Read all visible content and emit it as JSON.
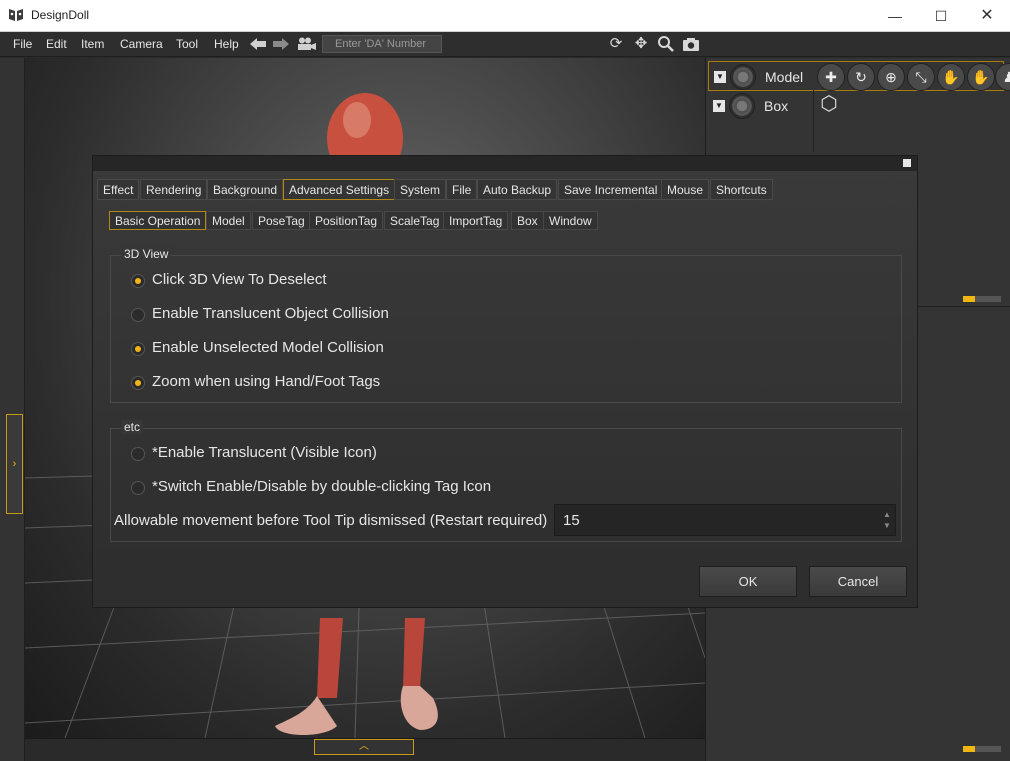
{
  "window": {
    "title": "DesignDoll"
  },
  "menu": {
    "items": [
      "File",
      "Edit",
      "Item",
      "Camera",
      "Tool",
      "Help"
    ],
    "da_placeholder": "Enter 'DA' Number"
  },
  "scene": {
    "objects": [
      "Model",
      "Box"
    ]
  },
  "dialog": {
    "tabs": [
      "Effect",
      "Rendering",
      "Background",
      "Advanced Settings",
      "System",
      "File",
      "Auto Backup",
      "Save Incremental",
      "Mouse",
      "Shortcuts"
    ],
    "active_tab": "Advanced Settings",
    "subtabs": [
      "Basic Operation",
      "Model",
      "PoseTag",
      "PositionTag",
      "ScaleTag",
      "ImportTag",
      "Box",
      "Window"
    ],
    "active_subtab": "Basic Operation",
    "group_3dview": {
      "title": "3D View",
      "options": [
        {
          "label": "Click 3D View To Deselect",
          "selected": true
        },
        {
          "label": "Enable Translucent Object Collision",
          "selected": false
        },
        {
          "label": "Enable Unselected Model Collision",
          "selected": true
        },
        {
          "label": "Zoom when using Hand/Foot Tags",
          "selected": true
        }
      ]
    },
    "group_etc": {
      "title": "etc",
      "options": [
        {
          "label": "*Enable Translucent (Visible Icon)",
          "selected": false
        },
        {
          "label": "*Switch Enable/Disable by double-clicking Tag Icon",
          "selected": false
        }
      ],
      "movement_label": "Allowable movement before Tool Tip dismissed (Restart required)",
      "movement_value": "15"
    },
    "ok_label": "OK",
    "cancel_label": "Cancel"
  },
  "colors": {
    "accent": "#f2b614",
    "figure": "#c8503f"
  }
}
